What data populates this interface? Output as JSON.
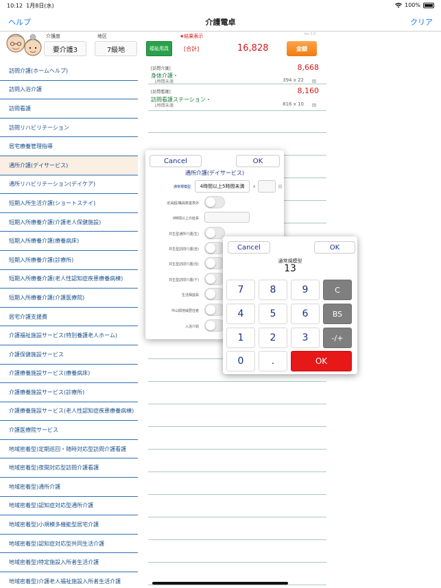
{
  "status": {
    "time": "10:12",
    "date": "1月8日(水)",
    "battery": "100%"
  },
  "nav": {
    "help": "ヘルプ",
    "title": "介護電卓",
    "clear": "クリア"
  },
  "header": {
    "care_level_label": "介護度",
    "care_level": "要介護3",
    "region_label": "地区",
    "region": "7級地",
    "welfare_button": "福祉用具",
    "result_note": "★結果表示",
    "version": "Ver.3.8",
    "total_label": "[合計]",
    "total_value": "16,828",
    "amount_button": "金額"
  },
  "services": [
    "訪問介護(ホームヘルプ)",
    "訪問入浴介護",
    "訪問看護",
    "訪問リハビリテーション",
    "居宅療養管理指導",
    "通所介護(デイサービス)",
    "通所リハビリテーション(デイケア)",
    "短期入所生活介護(ショートステイ)",
    "短期入所療養介護(介護老人保健施設)",
    "短期入所療養介護(療養病床)",
    "短期入所療養介護(診療所)",
    "短期入所療養介護(老人性認知症疾患療養病棟)",
    "短期入所療養介護(介護医療院)",
    "居宅介護支援費",
    "介護福祉施設サービス(特別養護老人ホーム)",
    "介護保健施設サービス",
    "介護療養施設サービス(療養病床)",
    "介護療養施設サービス(診療所)",
    "介護療養施設サービス(老人性認知症疾患療養病棟)",
    "介護医療院サービス",
    "地域密着型)定期巡回・随時対応型訪問介護看護",
    "地域密着型)夜間対応型訪問介護看護",
    "地域密着型)通所介護",
    "地域密着型)認知症対応型通所介護",
    "地域密着型)小規模多機能型居宅介護",
    "地域密着型)認知症対応型共同生活介護",
    "地域密着型)特定施設入所者生活介護",
    "地域密着型)介護老人福祉施設入所者生活介護"
  ],
  "entries": [
    {
      "tag": "[訪問介護]",
      "amount": "8,668",
      "name": "身体介護・",
      "sub": "1時間未満",
      "calc": "394 x 22",
      "unit": "回"
    },
    {
      "tag": "[訪問看護]",
      "amount": "8,160",
      "name": "訪問看護ステーション・",
      "sub": "1時間未満",
      "calc": "816 x 10",
      "unit": "回"
    }
  ],
  "popup1": {
    "cancel": "Cancel",
    "ok": "OK",
    "title": "通所介護(デイサービス)",
    "type_label": "通常規模型",
    "duration": "4時間以上5時間未満",
    "times_sign": "x",
    "times_unit": "回",
    "rows": [
      "定員超/職員数基準外",
      "9時間以上の延長",
      "共生型通所介護(生)",
      "共生型訪問介護(自)",
      "共生型訪問介護(児)",
      "共生型訪問介護(デ)",
      "生活相談員",
      "中山間地域居住者",
      "入浴介助"
    ]
  },
  "popup2": {
    "cancel": "Cancel",
    "ok": "OK",
    "title": "通常規模型",
    "value": "13",
    "keys": {
      "k7": "7",
      "k8": "8",
      "k9": "9",
      "c": "C",
      "k4": "4",
      "k5": "5",
      "k6": "6",
      "bs": "BS",
      "k1": "1",
      "k2": "2",
      "k3": "3",
      "sign": "-/+",
      "k0": "0",
      "dot": ".",
      "enter": "OK"
    }
  }
}
